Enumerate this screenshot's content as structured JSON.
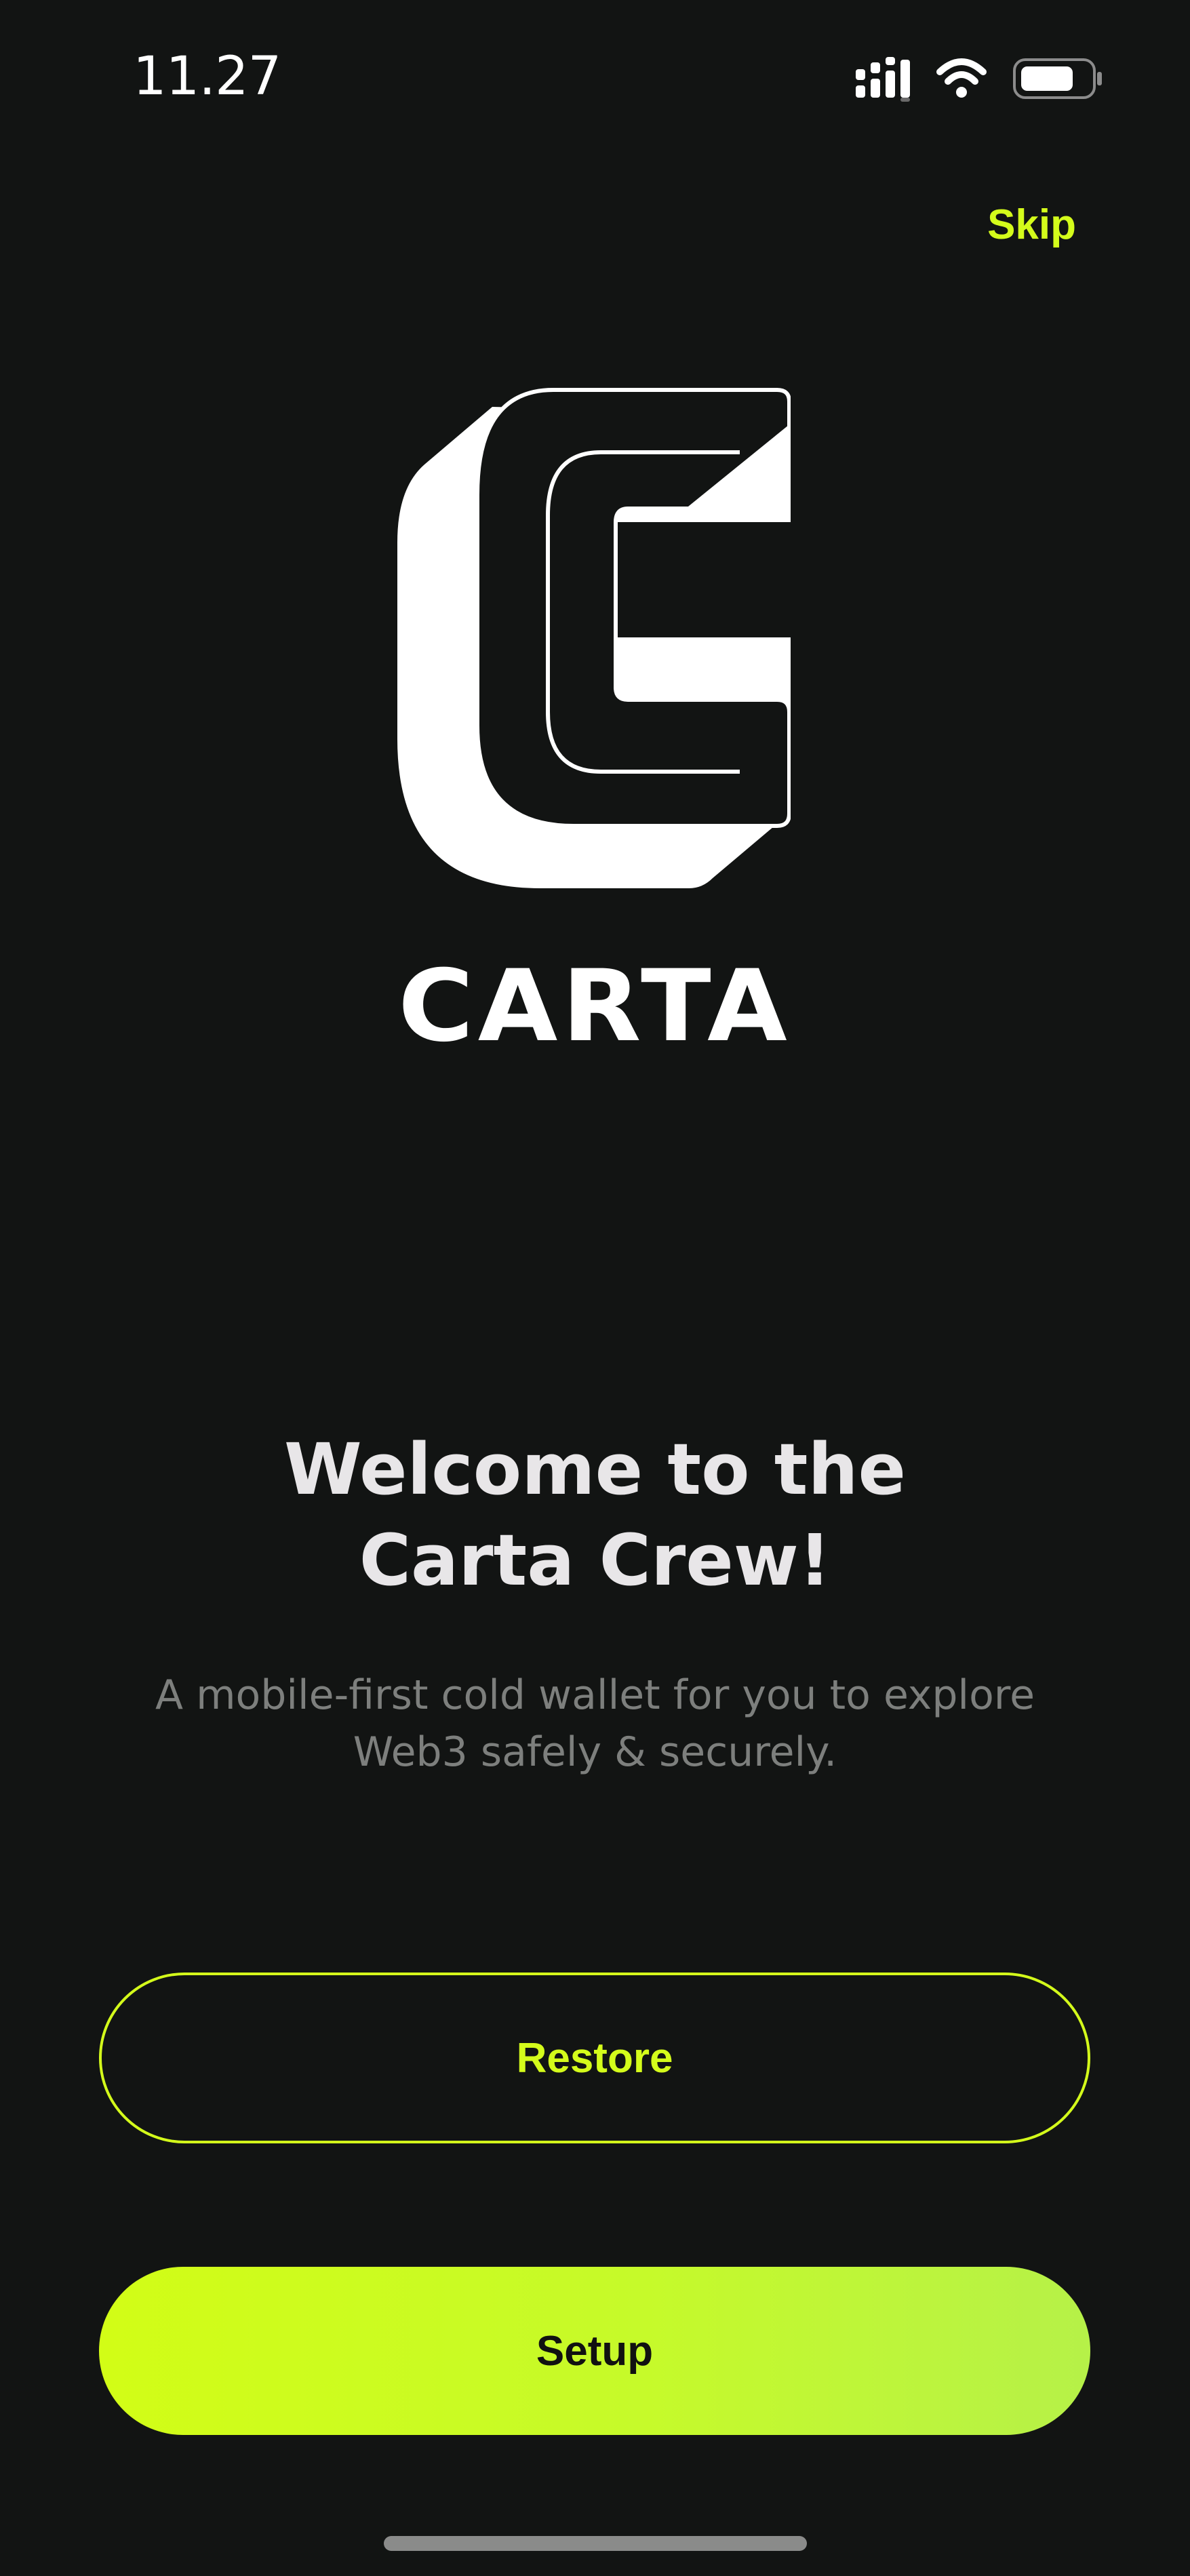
{
  "status_bar": {
    "time": "11.27",
    "icons": [
      "cellular-signal-icon",
      "wifi-icon",
      "battery-icon"
    ]
  },
  "header": {
    "skip_label": "Skip"
  },
  "logo": {
    "wordmark": "CARTA"
  },
  "welcome": {
    "title_line1": "Welcome to the",
    "title_line2": "Carta Crew!",
    "subtitle_line1": "A mobile-first cold wallet for you to explore",
    "subtitle_line2": "Web3 safely & securely."
  },
  "actions": {
    "restore_label": "Restore",
    "setup_label": "Setup"
  },
  "colors": {
    "background": "#121413",
    "accent": "#d4fc1b",
    "title_text": "#e8e6e8",
    "subtitle_text": "#7d7f7d"
  }
}
